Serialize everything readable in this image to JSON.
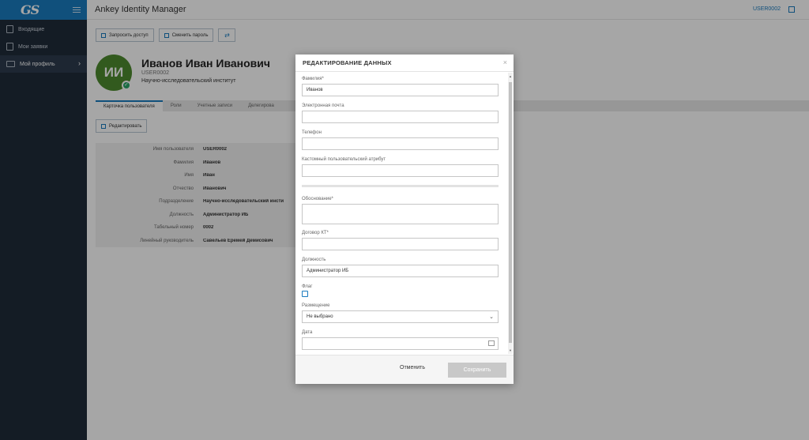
{
  "app": {
    "logo": "GS",
    "title": "Ankey Identity Manager",
    "user_code": "USER0002"
  },
  "sidebar": {
    "items": [
      {
        "label": "Входящие",
        "icon": "inbox-icon"
      },
      {
        "label": "Мои заявки",
        "icon": "requests-icon"
      },
      {
        "label": "Мой профиль",
        "icon": "profile-card-icon",
        "active": true
      }
    ]
  },
  "actions": {
    "request_access": "Запросить доступ",
    "change_password": "Сменить пароль",
    "transfer_icon": "⇄"
  },
  "profile": {
    "initials": "ИИ",
    "name": "Иванов Иван Иванович",
    "code": "USER0002",
    "org": "Научно-исследовательский институт"
  },
  "tabs": [
    "Карточка пользователя",
    "Роли",
    "Учетные записи",
    "Делегирова"
  ],
  "edit_button": "Редактировать",
  "info_table": [
    {
      "label": "Имя пользователя",
      "value": "USER0002"
    },
    {
      "label": "Фамилия",
      "value": "Иванов"
    },
    {
      "label": "Имя",
      "value": "Иван"
    },
    {
      "label": "Отчество",
      "value": "Иванович"
    },
    {
      "label": "Подразделение",
      "value": "Научно-исследовательский инсти"
    },
    {
      "label": "Должность",
      "value": "Администратор ИБ"
    },
    {
      "label": "Табельный номер",
      "value": "0002"
    },
    {
      "label": "Линейный руководитель",
      "value": "Савельев Еремей Демисович"
    }
  ],
  "modal": {
    "title": "РЕДАКТИРОВАНИЕ ДАННЫХ",
    "close": "×",
    "fields": {
      "surname": {
        "label": "Фамилия*",
        "value": "Иванов"
      },
      "email": {
        "label": "Электронная почта",
        "value": ""
      },
      "phone": {
        "label": "Телефон",
        "value": ""
      },
      "custom": {
        "label": "Кастомный пользовательский атрибут",
        "value": ""
      },
      "reason": {
        "label": "Обоснование*",
        "value": ""
      },
      "contract": {
        "label": "Договор КТ*",
        "value": ""
      },
      "position": {
        "label": "Должность",
        "value": "Администратор ИБ"
      },
      "flag": {
        "label": "Флаг",
        "checked": false
      },
      "placement": {
        "label": "Размещение",
        "value": "Не выбрано"
      },
      "date": {
        "label": "Дата",
        "value": ""
      }
    },
    "cancel": "Отменить",
    "save": "Сохранить"
  },
  "colors": {
    "brand": "#1a7bbf",
    "sidebar": "#1f2b3a",
    "avatar": "#4e8a2e",
    "status_ok": "#27a568"
  }
}
